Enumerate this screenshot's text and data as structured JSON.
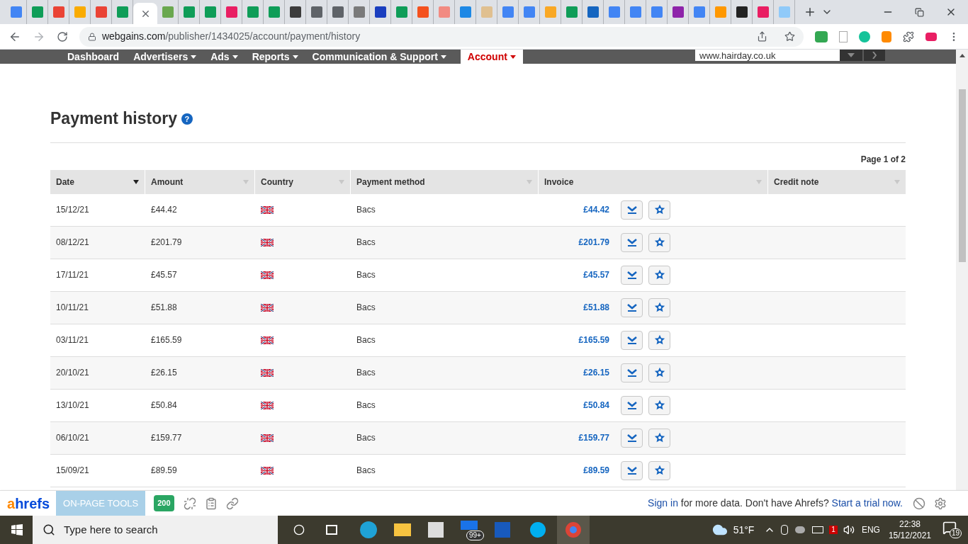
{
  "browser": {
    "tabs": [
      {
        "color": "#4285f4",
        "selected": false
      },
      {
        "color": "#0f9d58",
        "selected": false
      },
      {
        "color": "#ea4335",
        "selected": false
      },
      {
        "color": "#f9ab00",
        "selected": false
      },
      {
        "color": "#ea4335",
        "selected": false
      },
      {
        "color": "#0f9d58",
        "selected": false
      },
      {
        "color": "#5f6368",
        "selected": true
      },
      {
        "color": "#6aa84f",
        "selected": false
      },
      {
        "color": "#0f9d58",
        "selected": false
      },
      {
        "color": "#0f9d58",
        "selected": false
      },
      {
        "color": "#e91e63",
        "selected": false
      },
      {
        "color": "#0f9d58",
        "selected": false
      },
      {
        "color": "#0f9d58",
        "selected": false
      },
      {
        "color": "#3c3c3c",
        "selected": false
      },
      {
        "color": "#5f6368",
        "selected": false
      },
      {
        "color": "#5f6368",
        "selected": false
      },
      {
        "color": "#7a7a7a",
        "selected": false
      },
      {
        "color": "#1a3ebf",
        "selected": false
      },
      {
        "color": "#0f9d58",
        "selected": false
      },
      {
        "color": "#f4511e",
        "selected": false
      },
      {
        "color": "#f28b82",
        "selected": false
      },
      {
        "color": "#1e88e5",
        "selected": false
      },
      {
        "color": "#e0c090",
        "selected": false
      },
      {
        "color": "#4285f4",
        "selected": false
      },
      {
        "color": "#4285f4",
        "selected": false
      },
      {
        "color": "#f9a825",
        "selected": false
      },
      {
        "color": "#0f9d58",
        "selected": false
      },
      {
        "color": "#1565c0",
        "selected": false
      },
      {
        "color": "#4285f4",
        "selected": false
      },
      {
        "color": "#4285f4",
        "selected": false
      },
      {
        "color": "#4285f4",
        "selected": false
      },
      {
        "color": "#8e24aa",
        "selected": false
      },
      {
        "color": "#4285f4",
        "selected": false
      },
      {
        "color": "#ff9800",
        "selected": false
      },
      {
        "color": "#222222",
        "selected": false
      },
      {
        "color": "#e91e63",
        "selected": false
      },
      {
        "color": "#90caf9",
        "selected": false
      }
    ],
    "url_host": "webgains.com",
    "url_path": "/publisher/1434025/account/payment/history"
  },
  "nav": {
    "items": [
      {
        "label": "Dashboard",
        "dropdown": false,
        "selected": false
      },
      {
        "label": "Advertisers",
        "dropdown": true,
        "selected": false
      },
      {
        "label": "Ads",
        "dropdown": true,
        "selected": false
      },
      {
        "label": "Reports",
        "dropdown": true,
        "selected": false
      },
      {
        "label": "Communication & Support",
        "dropdown": true,
        "selected": false
      },
      {
        "label": "Account",
        "dropdown": true,
        "selected": true
      }
    ],
    "site_value": "www.hairday.co.uk"
  },
  "page": {
    "title": "Payment history",
    "help_icon": "?",
    "pagination": "Page 1 of 2"
  },
  "table": {
    "columns": [
      {
        "label": "Date",
        "sorted": true
      },
      {
        "label": "Amount",
        "sorted": false
      },
      {
        "label": "Country",
        "sorted": false
      },
      {
        "label": "Payment method",
        "sorted": false
      },
      {
        "label": "Invoice",
        "sorted": false
      },
      {
        "label": "Credit note",
        "sorted": false
      }
    ],
    "rows": [
      {
        "date": "15/12/21",
        "amount": "£44.42",
        "method": "Bacs",
        "invoice": "£44.42"
      },
      {
        "date": "08/12/21",
        "amount": "£201.79",
        "method": "Bacs",
        "invoice": "£201.79"
      },
      {
        "date": "17/11/21",
        "amount": "£45.57",
        "method": "Bacs",
        "invoice": "£45.57"
      },
      {
        "date": "10/11/21",
        "amount": "£51.88",
        "method": "Bacs",
        "invoice": "£51.88"
      },
      {
        "date": "03/11/21",
        "amount": "£165.59",
        "method": "Bacs",
        "invoice": "£165.59"
      },
      {
        "date": "20/10/21",
        "amount": "£26.15",
        "method": "Bacs",
        "invoice": "£26.15"
      },
      {
        "date": "13/10/21",
        "amount": "£50.84",
        "method": "Bacs",
        "invoice": "£50.84"
      },
      {
        "date": "06/10/21",
        "amount": "£159.77",
        "method": "Bacs",
        "invoice": "£159.77"
      },
      {
        "date": "15/09/21",
        "amount": "£89.59",
        "method": "Bacs",
        "invoice": "£89.59"
      }
    ]
  },
  "ahrefs": {
    "logo_a": "a",
    "logo_rest": "hrefs",
    "tools_label": "ON-PAGE TOOLS",
    "status": "200",
    "sign_in": "Sign in",
    "middle": "for more data. Don't have Ahrefs?",
    "trial": "Start a trial now."
  },
  "taskbar": {
    "search_placeholder": "Type here to search",
    "mail_badge": "99+",
    "temperature": "51°F",
    "dropbox_badge": "1",
    "language": "ENG",
    "time": "22:38",
    "date": "15/12/2021",
    "notifications": "19"
  }
}
